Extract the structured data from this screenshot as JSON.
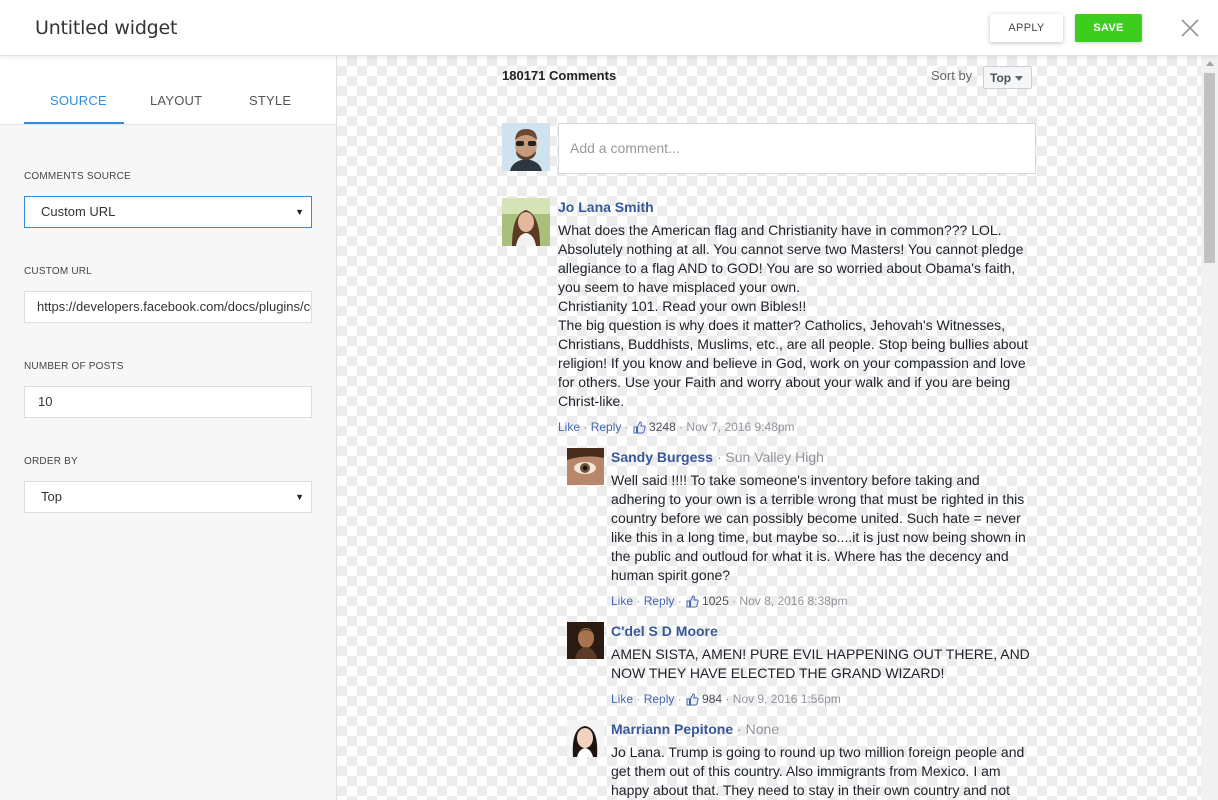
{
  "header": {
    "title": "Untitled widget",
    "apply_label": "APPLY",
    "save_label": "SAVE",
    "accent_color": "#3dcd1f"
  },
  "panel": {
    "tabs": [
      {
        "label": "SOURCE",
        "active": true
      },
      {
        "label": "LAYOUT",
        "active": false
      },
      {
        "label": "STYLE",
        "active": false
      }
    ],
    "comments_source": {
      "label": "COMMENTS SOURCE",
      "value": "Custom URL"
    },
    "custom_url": {
      "label": "CUSTOM URL",
      "value": "https://developers.facebook.com/docs/plugins/comments"
    },
    "number_of_posts": {
      "label": "NUMBER OF POSTS",
      "value": "10"
    },
    "order_by": {
      "label": "ORDER BY",
      "value": "Top"
    },
    "tab_accent_color": "#2d8fde"
  },
  "preview": {
    "count_text": "180171 Comments",
    "sort_label": "Sort by",
    "sort_value": "Top",
    "comment_placeholder": "Add a comment...",
    "comments": [
      {
        "author": "Jo Lana Smith",
        "affiliation": "",
        "lines": [
          "What does the American flag and Christianity have in common??? LOL.",
          "Absolutely nothing at all. You cannot serve two Masters! You cannot pledge",
          "allegiance to a flag AND to GOD! You are so worried about Obama's faith,",
          "you seem to have misplaced your own.",
          "Christianity 101. Read your own Bibles!!",
          "The big question is why does it matter? Catholics, Jehovah's Witnesses,",
          "Christians, Buddhists, Muslims, etc., are all people. Stop being bullies about",
          "religion! If you know and believe in God, work on your compassion and love",
          "for others. Use your Faith and worry about your walk and if you are being",
          "Christ-like."
        ],
        "like": "Like",
        "reply": "Reply",
        "likes": "3248",
        "time": "Nov 7, 2016 9:48pm"
      },
      {
        "author": "Sandy Burgess",
        "affiliation": "Sun Valley High",
        "lines": [
          "Well said !!!! To take someone's inventory before taking and",
          "adhering to your own is a terrible wrong that must be righted in this",
          "country before we can possibly become united. Such hate = never",
          "like this in a long time, but maybe so....it is just now being shown in",
          "the public and outloud for what it is. Where has the decency and",
          "human spirit gone?"
        ],
        "like": "Like",
        "reply": "Reply",
        "likes": "1025",
        "time": "Nov 8, 2016 8:38pm"
      },
      {
        "author": "C'del S D Moore",
        "affiliation": "",
        "lines": [
          "AMEN SISTA, AMEN! PURE EVIL HAPPENING OUT THERE, AND",
          "NOW THEY HAVE ELECTED THE GRAND WIZARD!"
        ],
        "like": "Like",
        "reply": "Reply",
        "likes": "984",
        "time": "Nov 9, 2016 1:56pm"
      },
      {
        "author": "Marriann Pepitone",
        "affiliation": "None",
        "lines": [
          "Jo Lana. Trump is going to round up two million foreign people and",
          "get them out of this country. Also immigrants from Mexico. I am",
          "happy about that. They need to stay in their own country and not"
        ],
        "like": "",
        "reply": "",
        "likes": "",
        "time": ""
      }
    ]
  }
}
